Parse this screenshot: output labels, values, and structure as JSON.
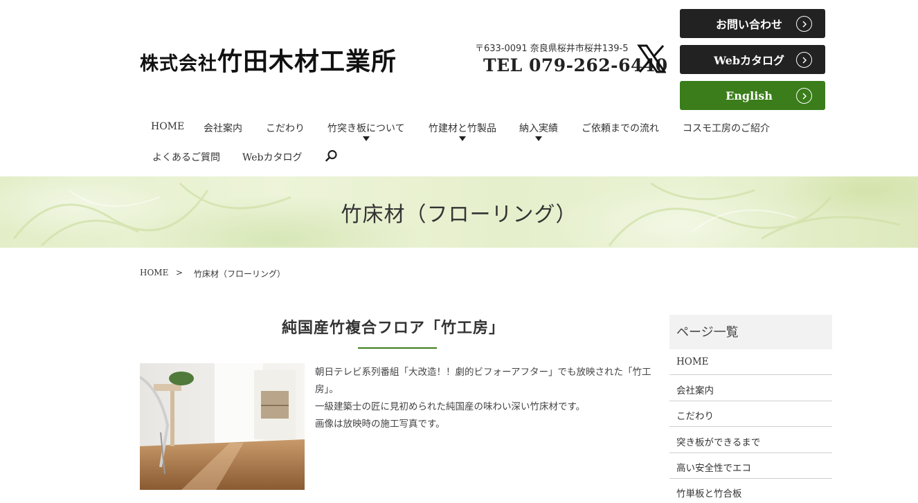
{
  "header": {
    "logo_prefix": "株式会社",
    "logo_main": "竹田木材工業所",
    "address": "〒633-0091 奈良県桜井市桜井139-5",
    "tel": "TEL 079-262-6440",
    "buttons": [
      {
        "label": "お問い合わせ"
      },
      {
        "label": "Webカタログ"
      },
      {
        "label": "English"
      }
    ],
    "accent": "#3a7d1a"
  },
  "nav": {
    "items": [
      {
        "label": "HOME"
      },
      {
        "label": "会社案内"
      },
      {
        "label": "こだわり"
      },
      {
        "label": "竹突き板について"
      },
      {
        "label": "竹建材と竹製品"
      },
      {
        "label": "納入実績"
      },
      {
        "label": "ご依頼までの流れ"
      },
      {
        "label": "コスモ工房のご紹介"
      },
      {
        "label": "よくあるご質問"
      },
      {
        "label": "Webカタログ"
      }
    ]
  },
  "banner": {
    "title": "竹床材（フローリング）"
  },
  "breadcrumb": {
    "home": "HOME",
    "separator": ">",
    "current": "竹床材（フローリング）"
  },
  "main": {
    "section_title": "純国産竹複合フロア「竹工房」",
    "paragraphs": [
      "朝日テレビ系列番組「大改造！！劇的ビフォーアフター」でも放映された「竹工房」。",
      "一級建築士の匠に見初められた純国産の味わい深い竹床材です。",
      "画像は放映時の施工写真です。"
    ]
  },
  "sidebar": {
    "heading": "ページ一覧",
    "items": [
      {
        "label": "HOME"
      },
      {
        "label": "会社案内"
      },
      {
        "label": "こだわり"
      },
      {
        "label": "突き板ができるまで"
      },
      {
        "label": "高い安全性でエコ"
      },
      {
        "label": "竹単板と竹合板"
      }
    ]
  }
}
